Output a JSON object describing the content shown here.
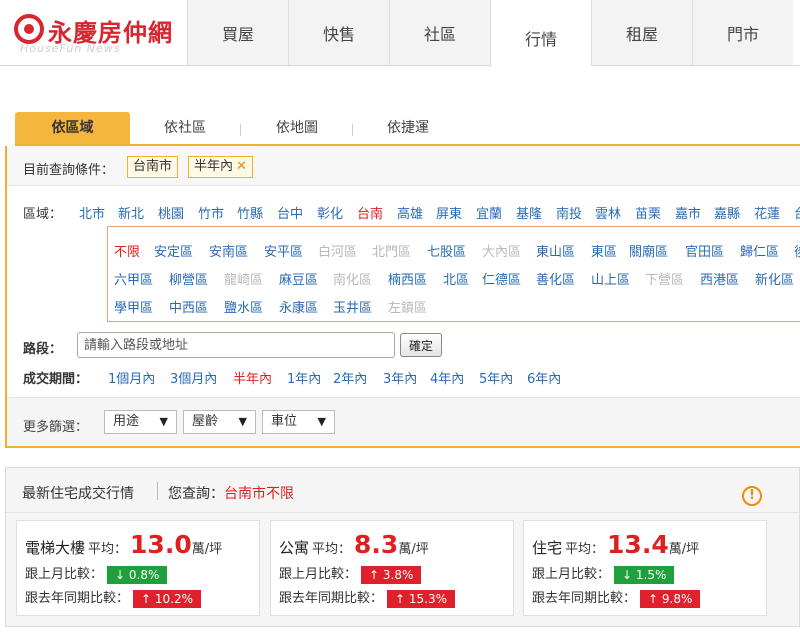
{
  "brand": {
    "name": "永慶房仲網",
    "sub": "HouseFun News"
  },
  "nav": [
    "買屋",
    "快售",
    "社區",
    "行情",
    "租屋",
    "門市"
  ],
  "tabs": [
    "依區域",
    "依社區",
    "依地圖",
    "依捷運"
  ],
  "conditions": {
    "label": "目前查詢條件：",
    "chips": [
      "台南市",
      "半年內"
    ],
    "remove_glyph": "✕"
  },
  "region": {
    "label": "區域：",
    "cities": [
      "北市",
      "新北",
      "桃園",
      "竹市",
      "竹縣",
      "台中",
      "彰化",
      "台南",
      "高雄",
      "屏東",
      "宜蘭",
      "基隆",
      "南投",
      "雲林",
      "苗栗",
      "嘉市",
      "嘉縣",
      "花蓮",
      "台"
    ],
    "active_city": "台南",
    "districts": [
      [
        "不限",
        "安定區",
        "安南區",
        "安平區",
        "白河區",
        "北門區",
        "七股區",
        "大內區",
        "東山區",
        "東區",
        "關廟區",
        "官田區",
        "歸仁區",
        "後"
      ],
      [
        "六甲區",
        "柳營區",
        "龍崎區",
        "麻豆區",
        "南化區",
        "楠西區",
        "北區",
        "仁德區",
        "善化區",
        "山上區",
        "下營區",
        "西港區",
        "新化區"
      ],
      [
        "學甲區",
        "中西區",
        "鹽水區",
        "永康區",
        "玉井區",
        "左鎮區"
      ]
    ]
  },
  "road": {
    "label": "路段：",
    "placeholder": "請輸入路段或地址",
    "confirm": "確定"
  },
  "period": {
    "label": "成交期間：",
    "options": [
      "1個月內",
      "3個月內",
      "半年內",
      "1年內",
      "2年內",
      "3年內",
      "4年內",
      "5年內",
      "6年內"
    ],
    "active": "半年內"
  },
  "more": {
    "label": "更多篩選：",
    "dropdowns": [
      "用途",
      "屋齡",
      "車位"
    ],
    "arrow": "▼"
  },
  "stats": {
    "title": "最新住宅成交行情",
    "query_label": "您查詢：",
    "query_value": "台南市不限",
    "warn": "!",
    "avg_label": "平均：",
    "unit": "萬/坪",
    "mom_label": "跟上月比較：",
    "yoy_label": "跟去年同期比較：",
    "cards": [
      {
        "name": "電梯大樓",
        "price": "13.0",
        "mom": "↓ 0.8%",
        "mom_dir": "down",
        "yoy": "↑ 10.2%",
        "yoy_dir": "up"
      },
      {
        "name": "公寓",
        "price": "8.3",
        "mom": "↑ 3.8%",
        "mom_dir": "up",
        "yoy": "↑ 15.3%",
        "yoy_dir": "up"
      },
      {
        "name": "住宅",
        "price": "13.4",
        "mom": "↓ 1.5%",
        "mom_dir": "down",
        "yoy": "↑ 9.8%",
        "yoy_dir": "up"
      }
    ]
  },
  "colors": {
    "brand_red": "#d7262f",
    "accent_orange": "#f2b02e",
    "link_blue": "#2a6bb3",
    "active_red": "#e02020",
    "up_red": "#e0202a",
    "down_green": "#20a03a"
  }
}
